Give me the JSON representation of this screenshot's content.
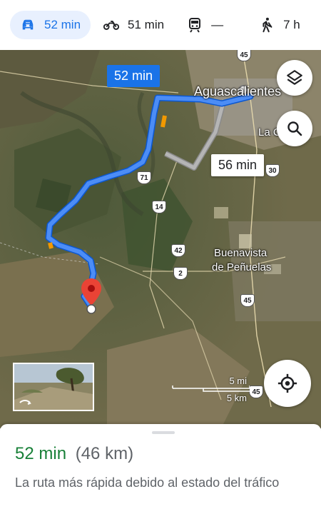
{
  "modes": [
    {
      "id": "drive",
      "icon": "car-icon",
      "label": "52 min",
      "active": true
    },
    {
      "id": "motorcycle",
      "icon": "motorcycle-icon",
      "label": "51 min",
      "active": false
    },
    {
      "id": "transit",
      "icon": "train-icon",
      "label": "—",
      "active": false
    },
    {
      "id": "walk",
      "icon": "walking-icon",
      "label": "7 h",
      "active": false
    },
    {
      "id": "rideshare",
      "icon": "hailing-person-icon",
      "label": "",
      "active": false
    }
  ],
  "map": {
    "place_labels": {
      "city": "Aguascalientes",
      "town_right": "La Cañada",
      "town_line1": "Buenavista",
      "town_line2": "de Peñuelas"
    },
    "route_shields": [
      "45",
      "71",
      "14",
      "42",
      "2",
      "45",
      "30",
      "45"
    ],
    "primary_route_time": "52 min",
    "alternate_route_time": "56 min",
    "scale": {
      "miles": "5 mi",
      "km": "5 km"
    },
    "colors": {
      "primary_route": "#1a73e8",
      "alternate_route": "#a9a9a9",
      "traffic_slow": "#f29900",
      "pin": "#ea4335"
    }
  },
  "sheet": {
    "duration": "52 min",
    "distance": "(46 km)",
    "description": "La ruta más rápida debido al estado del tráfico"
  }
}
